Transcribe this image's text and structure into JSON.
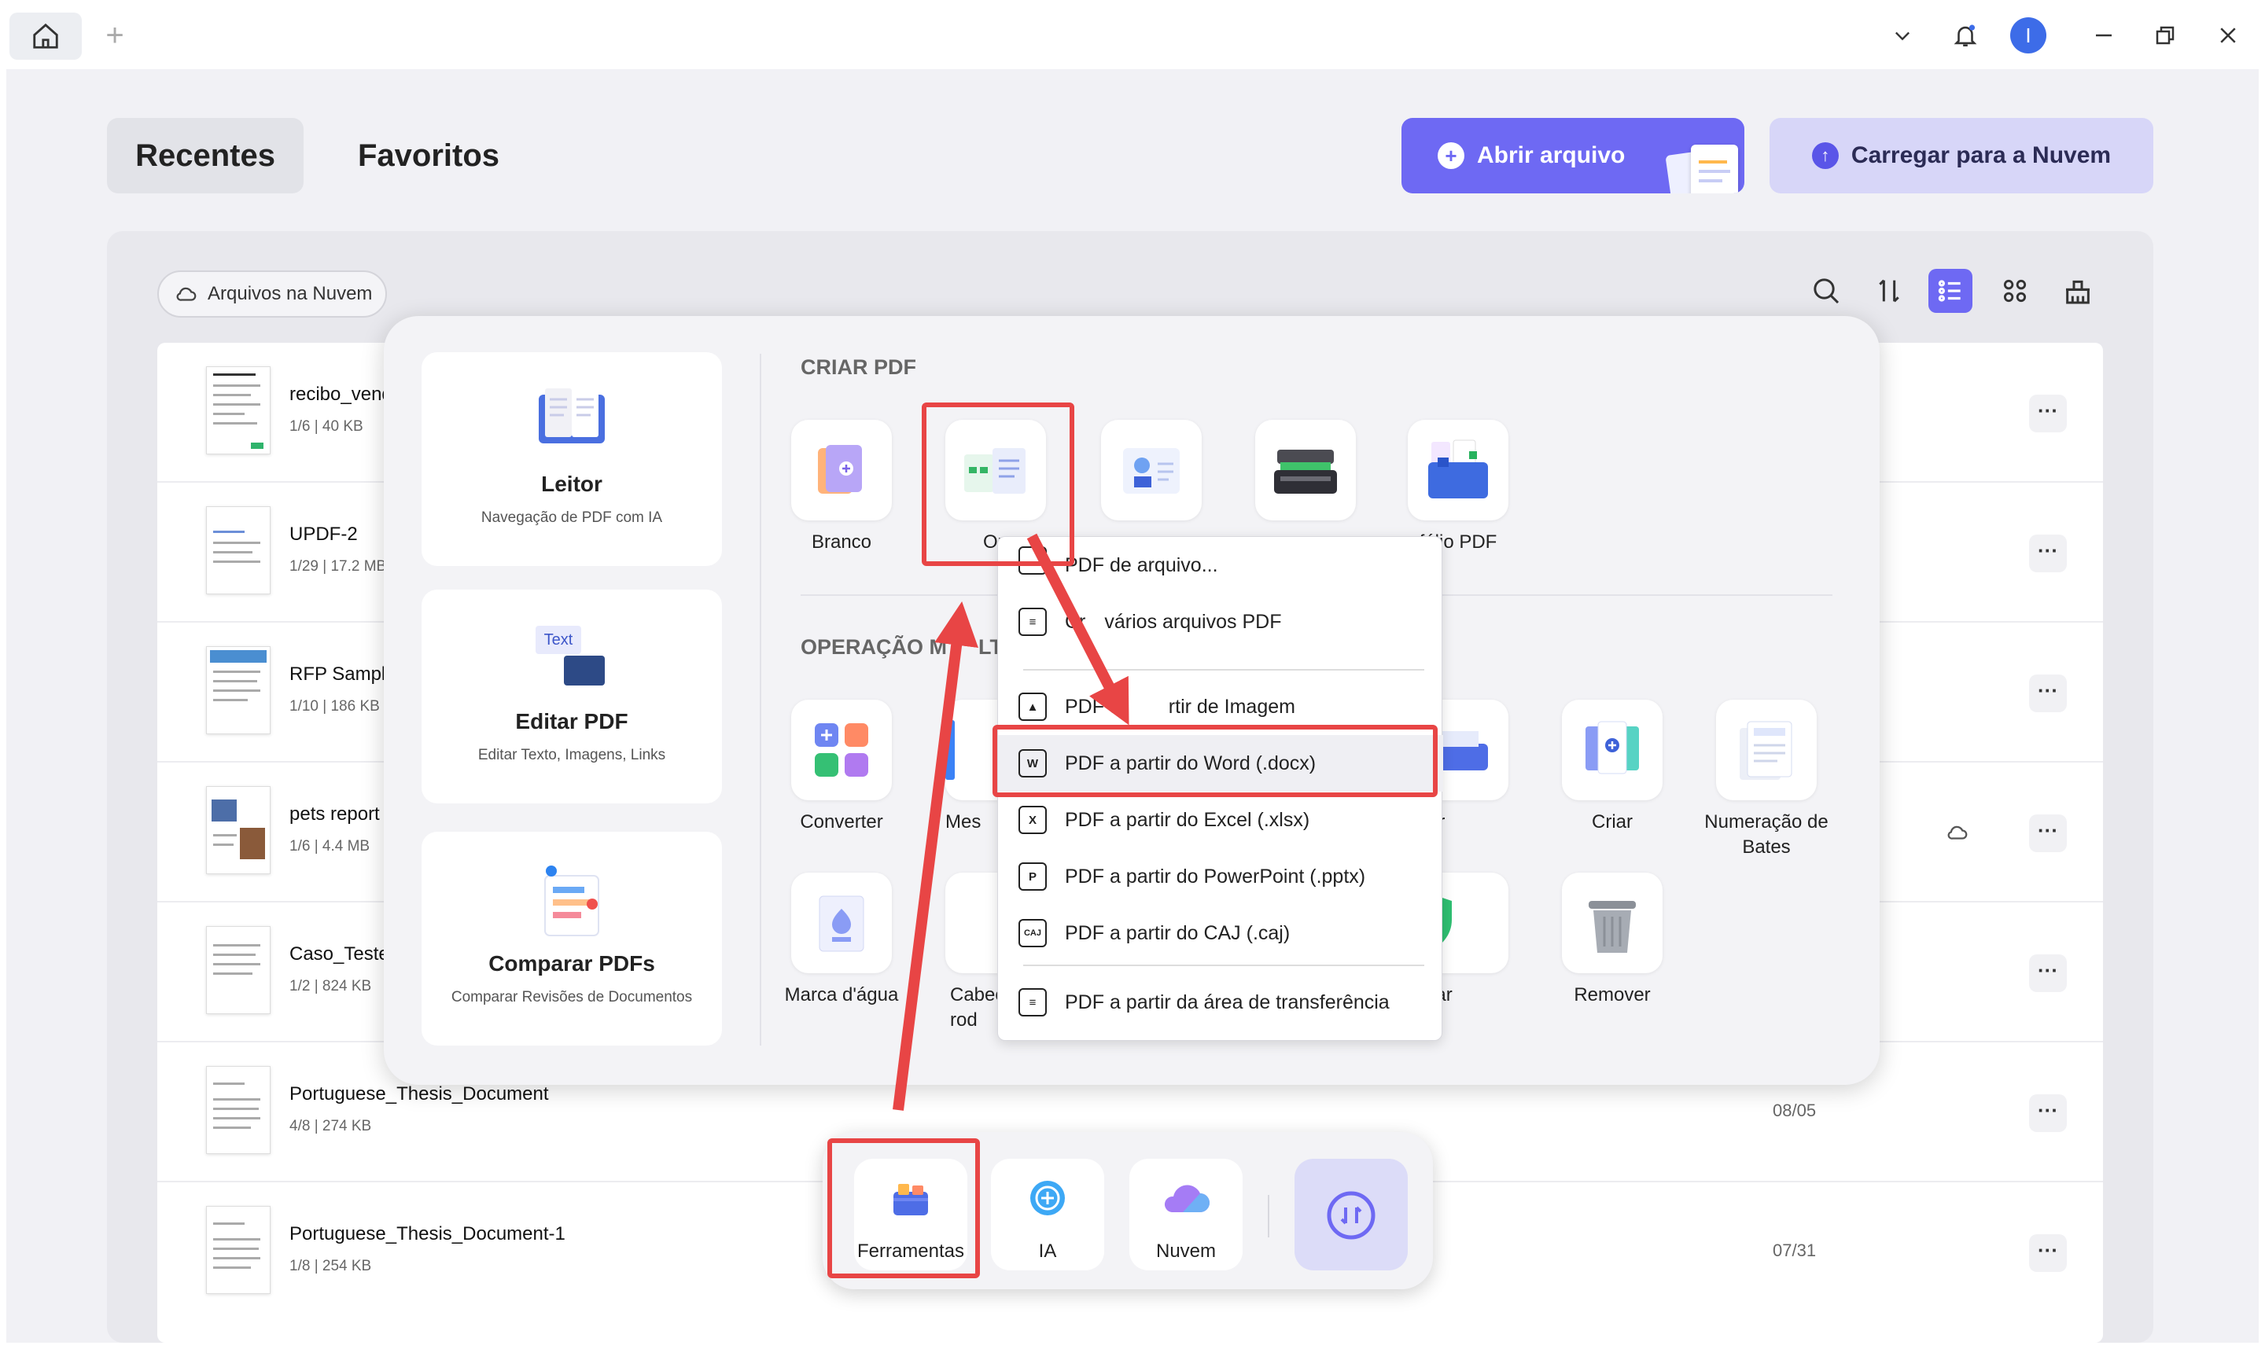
{
  "titlebar": {
    "icons": [
      "home-icon",
      "plus-icon",
      "chevron-down-icon",
      "bell-icon",
      "minimize-icon",
      "restore-icon",
      "close-icon"
    ],
    "avatar_letter": "I"
  },
  "header": {
    "tabs": [
      {
        "label": "Recentes",
        "active": true
      },
      {
        "label": "Favoritos",
        "active": false
      }
    ],
    "open_button": "Abrir arquivo",
    "upload_button": "Carregar para a Nuvem",
    "accent": "#6e69f3"
  },
  "toolbar": {
    "cloud_filter": "Arquivos na Nuvem",
    "icons": [
      "search-icon",
      "sort-icon",
      "list-view-icon",
      "grid-view-icon",
      "clean-icon"
    ]
  },
  "files": [
    {
      "name": "recibo_vend",
      "meta": "1/6 | 40 KB",
      "date": ""
    },
    {
      "name": "UPDF-2",
      "meta": "1/29 | 17.2 MB",
      "date": ""
    },
    {
      "name": "RFP Sample",
      "meta": "1/10 | 186 KB",
      "date": ""
    },
    {
      "name": "pets report",
      "meta": "1/6 | 4.4 MB",
      "date": ""
    },
    {
      "name": "Caso_Teste_",
      "meta": "1/2 | 824 KB",
      "date": ""
    },
    {
      "name": "Portuguese_Thesis_Document",
      "meta": "4/8 | 274 KB",
      "date": "08/05"
    },
    {
      "name": "Portuguese_Thesis_Document-1",
      "meta": "1/8 | 254 KB",
      "date": "07/31"
    }
  ],
  "popup": {
    "cards": [
      {
        "title": "Leitor",
        "subtitle": "Navegação de PDF com IA"
      },
      {
        "title": "Editar PDF",
        "subtitle": "Editar Texto, Imagens, Links"
      },
      {
        "title": "Comparar PDFs",
        "subtitle": "Comparar Revisões de Documentos"
      }
    ],
    "section_create": "CRIAR PDF",
    "section_batch": "OPERAÇÃO M",
    "section_batch_tail": "LTI-",
    "create_items": [
      "Branco",
      "Ou",
      "",
      "",
      "fólio PDF"
    ],
    "batch_row1": [
      "Converter",
      "Mes",
      "nprimir",
      "Criar",
      "Numeração de",
      "Bates"
    ],
    "batch_row2": [
      "Marca d'água",
      "Cabeç",
      "rod",
      "tografar",
      "Remover"
    ],
    "edit_icon_text": "Text"
  },
  "dropdown": {
    "items": [
      {
        "label": "PDF de arquivo...",
        "icon": "file-icon"
      },
      {
        "label": "Cr",
        "label_tail": "vários arquivos PDF",
        "icon": "multi-file-icon"
      },
      {
        "label": "PDF a ",
        "label_tail": "rtir de Imagem",
        "icon": "image-icon"
      },
      {
        "label": "PDF a partir do Word (.docx)",
        "icon": "word-icon",
        "badge": "W"
      },
      {
        "label": "PDF a partir do Excel (.xlsx)",
        "icon": "excel-icon",
        "badge": "X"
      },
      {
        "label": "PDF a partir do PowerPoint (.pptx)",
        "icon": "powerpoint-icon",
        "badge": "P"
      },
      {
        "label": "PDF a partir do CAJ (.caj)",
        "icon": "caj-icon",
        "badge": "CAJ"
      },
      {
        "label": "PDF a partir da área de transferência",
        "icon": "clipboard-icon"
      }
    ]
  },
  "dock": {
    "items": [
      {
        "label": "Ferramentas",
        "icon": "toolbox-icon"
      },
      {
        "label": "IA",
        "icon": "ai-icon"
      },
      {
        "label": "Nuvem",
        "icon": "cloud-icon"
      }
    ],
    "switch_icon": "switch-view-icon"
  },
  "annotation_color": "#e84545"
}
